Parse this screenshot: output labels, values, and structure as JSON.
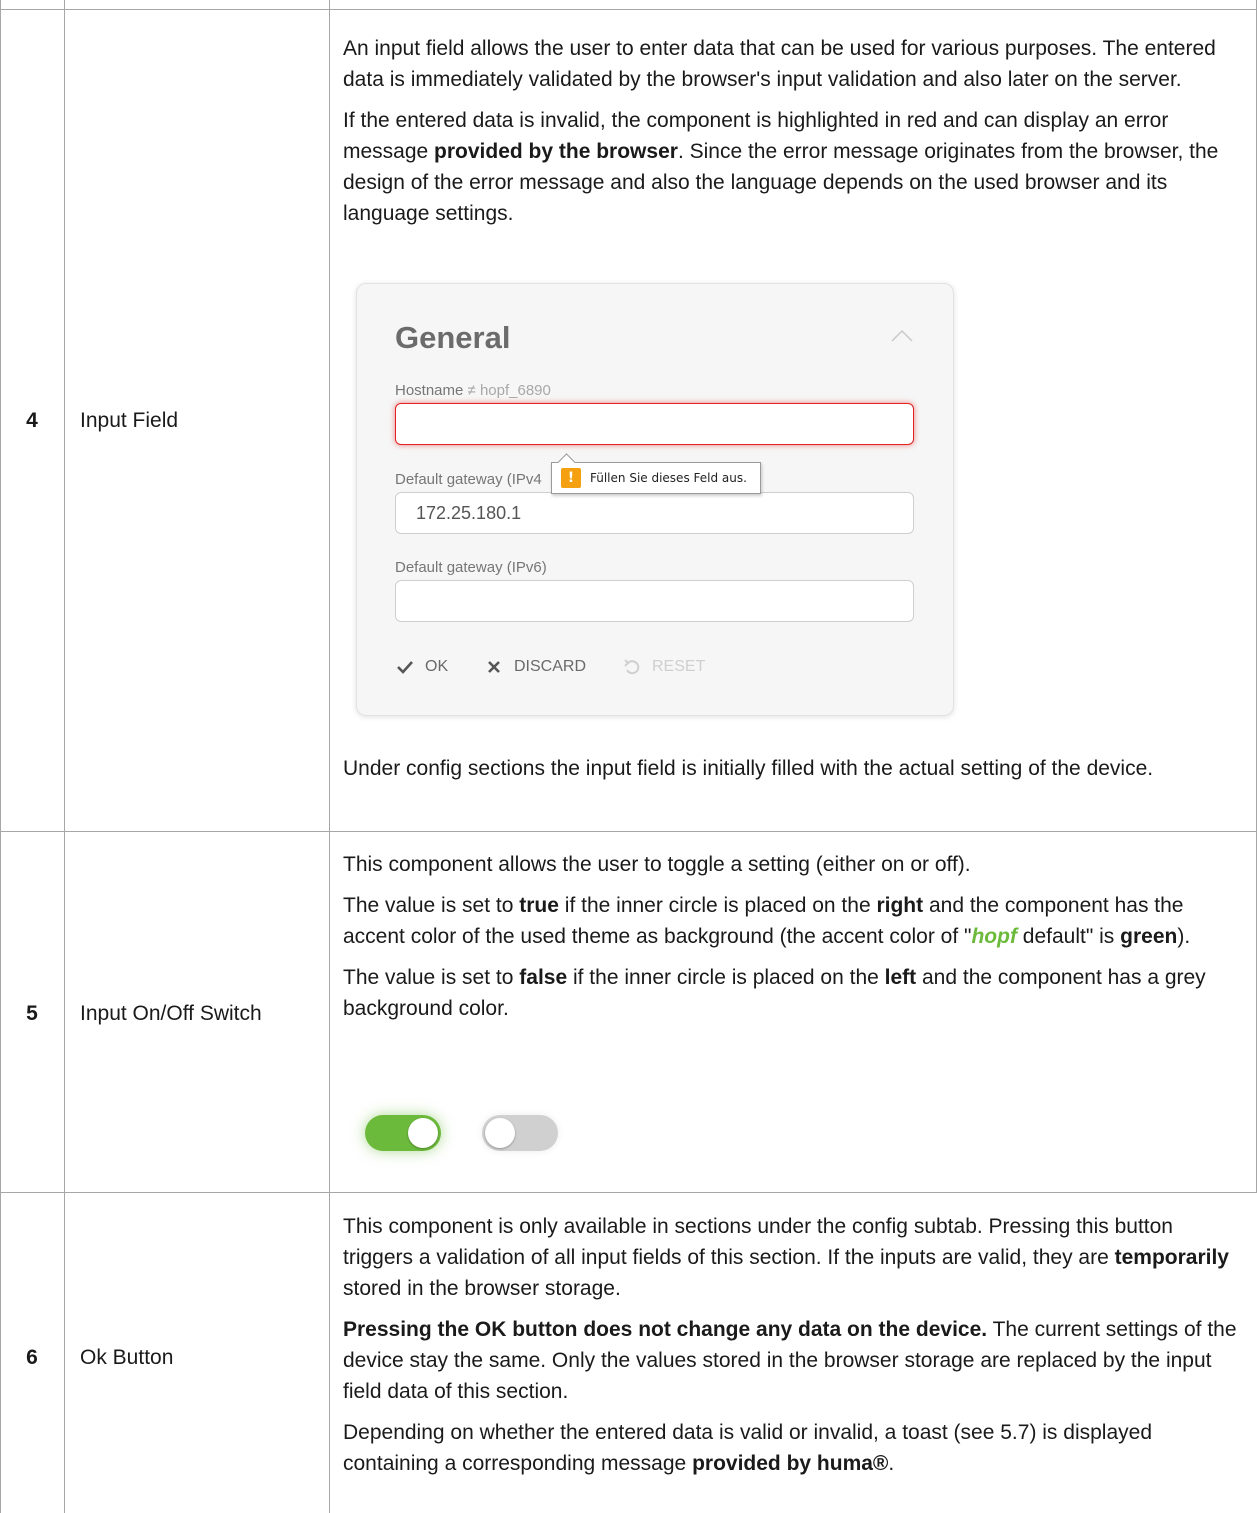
{
  "rows": [
    {
      "number": "4",
      "name": "Input Field",
      "p1": "An input field allows the user to enter data that can be used for various purposes. The entered data is immediately validated by the browser's input validation and also later on the server.",
      "p2_a": "If the entered data is invalid, the component is highlighted in red and can display an error message ",
      "p2_b": "provided by the browser",
      "p2_c": ". Since the error message originates from the browser, the design of the error message and also the language depends on the used browser and its language settings.",
      "p3": "Under config sections the input field is initially filled with the actual setting of the device."
    },
    {
      "number": "5",
      "name": "Input On/Off Switch",
      "p1": "This component allows the user to toggle a setting (either on or off).",
      "p2_a": "The value is set to ",
      "p2_b": "true",
      "p2_c": " if the inner circle is placed on the ",
      "p2_d": "right",
      "p2_e": " and the component has the accent color of the used theme as background (the accent color of \"",
      "p2_f": "hopf",
      "p2_g": " default\" is ",
      "p2_h": "green",
      "p2_i": ").",
      "p3_a": "The value is set to ",
      "p3_b": "false",
      "p3_c": " if the inner circle is placed on the ",
      "p3_d": "left",
      "p3_e": " and the component has a grey background color."
    },
    {
      "number": "6",
      "name": "Ok Button",
      "p1_a": "This component is only available in sections under the config subtab. Pressing this button triggers a validation of all input fields of this section. If the inputs are valid, they are ",
      "p1_b": "temporarily",
      "p1_c": " stored in the browser storage.",
      "p2_a": "Pressing the OK button does not change any data on the device.",
      "p2_b": " The current settings of the device stay the same. Only the values stored in the browser storage are replaced by the input field data of this section.",
      "p3_a": "Depending on whether the entered data is valid or invalid, a toast (see 5.7) is displayed containing a corresponding message ",
      "p3_b": "provided by huma®",
      "p3_c": "."
    }
  ],
  "card": {
    "title": "General",
    "hostname_label": "Hostname",
    "hostname_hint": "≠ hopf_6890",
    "hostname_value": "",
    "gw4_label": "Default gateway (IPv4",
    "gw4_value": "172.25.180.1",
    "gw6_label": "Default gateway (IPv6)",
    "gw6_value": "",
    "tooltip_icon": "!",
    "tooltip_message": "Füllen Sie dieses Feld aus.",
    "ok_label": "OK",
    "discard_label": "DISCARD",
    "reset_label": "RESET"
  },
  "toggles": [
    {
      "state": "on",
      "color": "#6cba3c"
    },
    {
      "state": "off",
      "color": "#d0d0d0"
    }
  ],
  "colors": {
    "accent": "#6cba3c",
    "error": "#e02424",
    "warning": "#f4a010",
    "grid": "#a6a6a6"
  }
}
